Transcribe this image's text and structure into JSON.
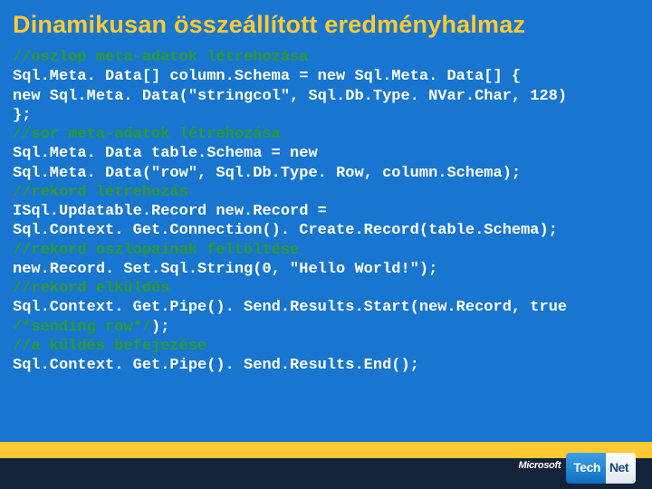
{
  "title": "Dinamikusan összeállított eredményhalmaz",
  "code": {
    "l0": "//oszlop meta-adatok létrehozása",
    "l1": "Sql.Meta. Data[] column.Schema = new Sql.Meta. Data[] {",
    "l2": "new Sql.Meta. Data(\"stringcol\", Sql.Db.Type. NVar.Char, 128)",
    "l3": "};",
    "l4": "//sor meta-adatok létrehozása",
    "l5": "Sql.Meta. Data table.Schema = new",
    "l6": "Sql.Meta. Data(\"row\", Sql.Db.Type. Row, column.Schema);",
    "l7": "//rekord létrehozás",
    "l8": "ISql.Updatable.Record new.Record =",
    "l9": "Sql.Context. Get.Connection(). Create.Record(table.Schema);",
    "l10": "//rekord oszlopainak feltöltése",
    "l11": "new.Record. Set.Sql.String(0, \"Hello World!\");",
    "l12": "//rekord elküldés",
    "l13a": "Sql.Context. Get.Pipe(). Send.Results.Start(new.Record, true",
    "l13b": "/*sending row*/",
    "l13c": ");",
    "l14": "//a küldés befejezése",
    "l15": "Sql.Context. Get.Pipe(). Send.Results.End();"
  },
  "footer": {
    "brand": "Microsoft",
    "logo_tech": "Tech",
    "logo_net": "Net"
  }
}
